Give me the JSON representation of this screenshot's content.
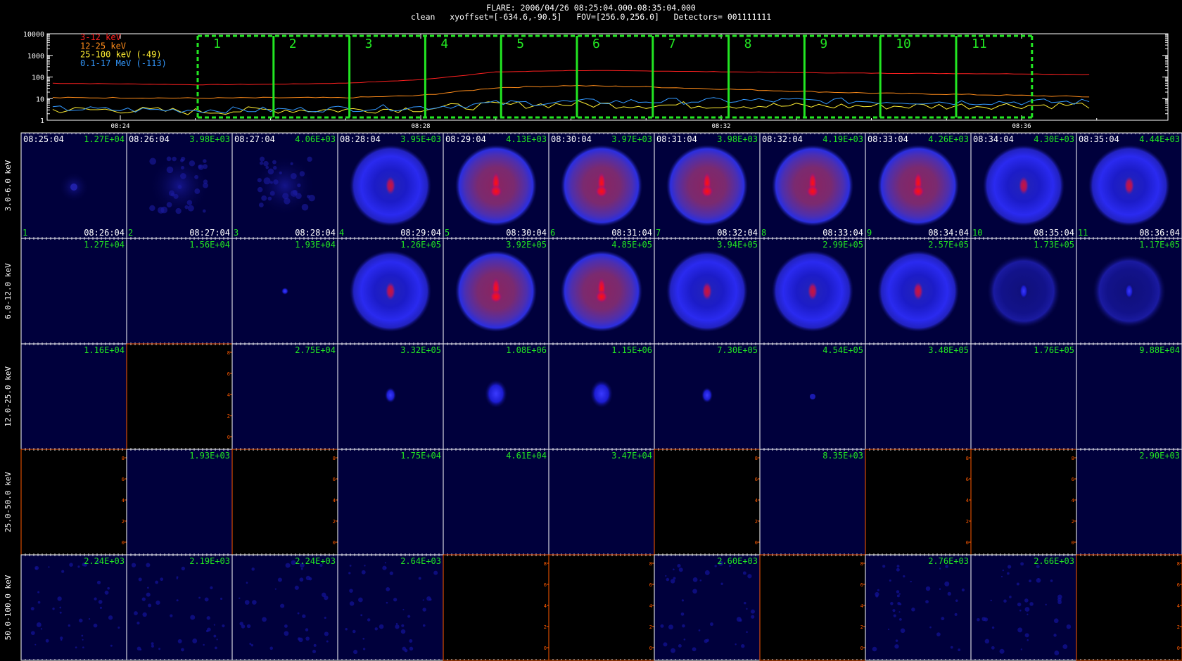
{
  "header": {
    "line1": "FLARE: 2006/04/26 08:25:04.000-08:35:04.000",
    "line2": "clean   xyoffset=[-634.6,-90.5]   FOV=[256.0,256.0]   Detectors= 001111111"
  },
  "colors": {
    "red": "#ff2020",
    "orange": "#ff8c1a",
    "yellow": "#ffee33",
    "blue": "#3399ff",
    "green": "#22e622",
    "orange_axis": "#ff5a00"
  },
  "lightcurve": {
    "y_ticks": [
      "10000",
      "1000",
      "100",
      "10",
      "1"
    ],
    "x_ticks": [
      "08:24",
      "08:28",
      "08:32",
      "08:36"
    ],
    "legend": [
      {
        "label": "3-12 keV",
        "color": "#ff2020"
      },
      {
        "label": "12-25 keV",
        "color": "#ff8c1a"
      },
      {
        "label": "25-100 keV (-49)",
        "color": "#ffee33"
      },
      {
        "label": "0.1-17 MeV (-113)",
        "color": "#3399ff"
      }
    ],
    "intervals": [
      "1",
      "2",
      "3",
      "4",
      "5",
      "6",
      "7",
      "8",
      "9",
      "10",
      "11"
    ]
  },
  "chart_data": {
    "type": "line",
    "title": "FLARE: 2006/04/26 08:25:04.000-08:35:04.000",
    "xlabel": "",
    "ylabel": "",
    "y_scale": "log",
    "ylim": [
      1,
      10000
    ],
    "x_ticks": [
      "08:24",
      "08:28",
      "08:32",
      "08:36"
    ],
    "x": [
      "08:23",
      "08:24",
      "08:25",
      "08:26",
      "08:27",
      "08:28",
      "08:29",
      "08:30",
      "08:31",
      "08:32",
      "08:33",
      "08:34",
      "08:35",
      "08:36",
      "08:37"
    ],
    "series": [
      {
        "name": "3-12 keV",
        "values": [
          52,
          48,
          44,
          46,
          52,
          75,
          170,
          200,
          190,
          175,
          160,
          150,
          145,
          140,
          130
        ]
      },
      {
        "name": "12-25 keV",
        "values": [
          11,
          11,
          10.5,
          11,
          11,
          14,
          32,
          40,
          35,
          28,
          22,
          18,
          16,
          14,
          12
        ]
      },
      {
        "name": "25-100 keV (-49)",
        "values": [
          3,
          3,
          2.5,
          3,
          3,
          3.5,
          5,
          5.5,
          5,
          5,
          4.5,
          4.5,
          4.5,
          5,
          5
        ]
      },
      {
        "name": "0.1-17 MeV (-113)",
        "values": [
          3.5,
          3,
          3,
          3,
          3.5,
          4,
          6,
          7,
          7.5,
          8,
          8,
          7.5,
          7,
          7,
          7
        ]
      }
    ]
  },
  "grid": {
    "rows": [
      "3.0-6.0 keV",
      "6.0-12.0 keV",
      "12.0-25.0 keV",
      "25.0-50.0 keV",
      "50.0-100.0 keV"
    ],
    "start_times": [
      "08:25:04",
      "08:26:04",
      "08:27:04",
      "08:28:04",
      "08:29:04",
      "08:30:04",
      "08:31:04",
      "08:32:04",
      "08:33:04",
      "08:34:04",
      "08:35:04"
    ],
    "end_times": [
      "08:26:04",
      "08:27:04",
      "08:28:04",
      "08:29:04",
      "08:30:04",
      "08:31:04",
      "08:32:04",
      "08:33:04",
      "08:34:04",
      "08:35:04",
      "08:36:04"
    ],
    "indices": [
      "1",
      "2",
      "3",
      "4",
      "5",
      "6",
      "7",
      "8",
      "9",
      "10",
      "11"
    ],
    "maxvals": [
      [
        "1.27E+04",
        "3.98E+03",
        "4.06E+03",
        "3.95E+03",
        "4.13E+03",
        "3.97E+03",
        "3.98E+03",
        "4.19E+03",
        "4.26E+03",
        "4.30E+03",
        "4.44E+03"
      ],
      [
        "1.27E+04",
        "1.56E+04",
        "1.93E+04",
        "1.26E+05",
        "3.92E+05",
        "4.85E+05",
        "3.94E+05",
        "2.99E+05",
        "2.57E+05",
        "1.73E+05",
        "1.17E+05"
      ],
      [
        "1.16E+04",
        "",
        "2.75E+04",
        "3.32E+05",
        "1.08E+06",
        "1.15E+06",
        "7.30E+05",
        "4.54E+05",
        "3.48E+05",
        "1.76E+05",
        "9.88E+04"
      ],
      [
        "",
        "1.93E+03",
        "",
        "1.75E+04",
        "4.61E+04",
        "3.47E+04",
        "",
        "8.35E+03",
        "",
        "",
        "2.90E+03"
      ],
      [
        "2.24E+03",
        "2.19E+03",
        "2.24E+03",
        "2.64E+03",
        "",
        "",
        "2.60E+03",
        "",
        "2.76E+03",
        "2.66E+03",
        ""
      ]
    ],
    "images": [
      [
        "faint",
        "ring-faint",
        "ring-faint",
        "blue-ring",
        "red-ring",
        "red-ring",
        "red-ring",
        "red-ring",
        "red-ring",
        "blue-ring",
        "blue-ring"
      ],
      [
        "empty",
        "empty",
        "dot",
        "blue-ring",
        "red-ring",
        "red-ring",
        "blue-ring",
        "blue-ring",
        "blue-ring",
        "dim-ring",
        "dim-ring"
      ],
      [
        "empty",
        "black",
        "empty",
        "small-src",
        "src",
        "src",
        "small-src",
        "tiny-src",
        "empty",
        "empty",
        "empty"
      ],
      [
        "black",
        "empty",
        "black",
        "empty",
        "empty",
        "empty",
        "black",
        "empty",
        "black",
        "black",
        "empty"
      ],
      [
        "noise",
        "noise",
        "noise",
        "noise",
        "black",
        "black",
        "noise",
        "black",
        "noise",
        "noise",
        "black"
      ]
    ],
    "side_ticks": [
      "8",
      "6",
      "4",
      "2",
      "0"
    ]
  }
}
